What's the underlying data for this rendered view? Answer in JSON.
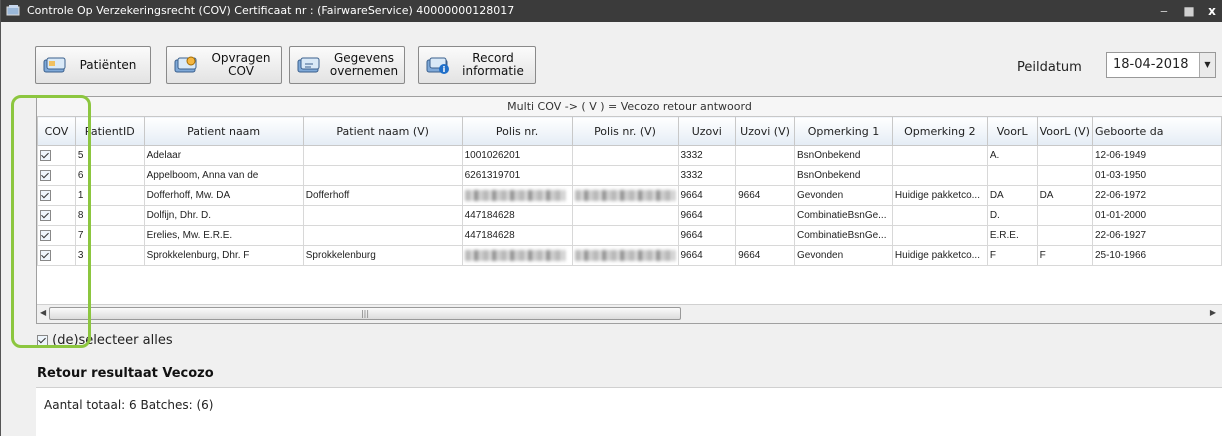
{
  "window": {
    "title": "Controle Op Verzekeringsrecht (COV) Certificaat nr : (FairwareService) 40000000128017"
  },
  "toolbar": {
    "patienten": "Patiënten",
    "opvragen_line1": "Opvragen",
    "opvragen_line2": "COV",
    "gegevens_line1": "Gegevens",
    "gegevens_line2": "overnemen",
    "record_line1": "Record",
    "record_line2": "informatie",
    "peildatum_label": "Peildatum",
    "peildatum_value": "18-04-2018"
  },
  "grid": {
    "caption": "Multi COV -> ( V ) = Vecozo retour antwoord",
    "columns": [
      "COV",
      "PatientID",
      "Patient naam",
      "Patient naam (V)",
      "Polis nr.",
      "Polis nr. (V)",
      "Uzovi",
      "Uzovi (V)",
      "Opmerking 1",
      "Opmerking 2",
      "VoorL",
      "VoorL (V)",
      "Geboorte da"
    ],
    "rows": [
      {
        "cov": true,
        "id": "5",
        "naam": "Adelaar",
        "naam_v": "",
        "polis": "1001026201",
        "polis_v": "",
        "uzovi": "3332",
        "uzovi_v": "",
        "opm1": "BsnOnbekend",
        "opm2": "",
        "voorl": "A.",
        "voorl_v": "",
        "geb": "12-06-1949"
      },
      {
        "cov": true,
        "id": "6",
        "naam": "Appelboom, Anna van de",
        "naam_v": "",
        "polis": "6261319701",
        "polis_v": "",
        "uzovi": "3332",
        "uzovi_v": "",
        "opm1": "BsnOnbekend",
        "opm2": "",
        "voorl": "",
        "voorl_v": "",
        "geb": "01-03-1950"
      },
      {
        "cov": true,
        "id": "1",
        "naam": "Dofferhoff, Mw. DA",
        "naam_v": "Dofferhoff",
        "polis": "",
        "polis_v": "",
        "uzovi": "9664",
        "uzovi_v": "9664",
        "opm1": "Gevonden",
        "opm2": "Huidige pakketco...",
        "voorl": "DA",
        "voorl_v": "DA",
        "geb": "22-06-1972"
      },
      {
        "cov": true,
        "id": "8",
        "naam": "Dolfijn, Dhr. D.",
        "naam_v": "",
        "polis": "447184628",
        "polis_v": "",
        "uzovi": "9664",
        "uzovi_v": "",
        "opm1": "CombinatieBsnGe...",
        "opm2": "",
        "voorl": "D.",
        "voorl_v": "",
        "geb": "01-01-2000"
      },
      {
        "cov": true,
        "id": "7",
        "naam": "Erelies, Mw. E.R.E.",
        "naam_v": "",
        "polis": "447184628",
        "polis_v": "",
        "uzovi": "9664",
        "uzovi_v": "",
        "opm1": "CombinatieBsnGe...",
        "opm2": "",
        "voorl": "E.R.E.",
        "voorl_v": "",
        "geb": "22-06-1927"
      },
      {
        "cov": true,
        "id": "3",
        "naam": "Sprokkelenburg, Dhr. F",
        "naam_v": "Sprokkelenburg",
        "polis": "",
        "polis_v": "",
        "uzovi": "9664",
        "uzovi_v": "9664",
        "opm1": "Gevonden",
        "opm2": "Huidige pakketco...",
        "voorl": "F",
        "voorl_v": "F",
        "geb": "25-10-1966"
      }
    ]
  },
  "select_all": "(de)selecteer alles",
  "result": {
    "title": "Retour resultaat Vecozo",
    "summary": "Aantal totaal: 6  Batches: (6)"
  },
  "colors": {
    "highlight": "#8cc63f",
    "titlebar": "#3b3b3b"
  }
}
